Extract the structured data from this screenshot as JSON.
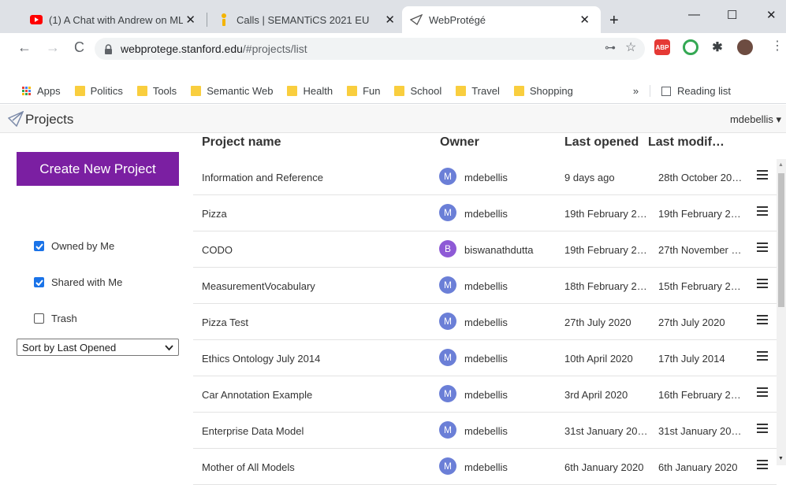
{
  "browser": {
    "tabs": [
      {
        "label": "(1) A Chat with Andrew on ML",
        "icon": "youtube-icon",
        "active": false
      },
      {
        "label": "Calls | SEMANTiCS 2021 EU",
        "icon": "semantics-icon",
        "active": false
      },
      {
        "label": "WebProtégé",
        "icon": "webprotege-icon",
        "active": true
      }
    ],
    "new_tab": "+",
    "url_host": "webprotege.stanford.edu",
    "url_path": "/#projects/list",
    "bookmarks": [
      "Apps",
      "Politics",
      "Tools",
      "Semantic Web",
      "Health",
      "Fun",
      "School",
      "Travel",
      "Shopping"
    ],
    "bookmarks_more": "»",
    "reading_list": "Reading list",
    "ext_abp": "ABP"
  },
  "app": {
    "title": "Projects",
    "user": "mdebellis ▾"
  },
  "sidebar": {
    "create_button": "Create New Project",
    "filters": [
      {
        "label": "Owned by Me",
        "checked": true
      },
      {
        "label": "Shared with Me",
        "checked": true
      },
      {
        "label": "Trash",
        "checked": false
      }
    ],
    "sort": "Sort by Last Opened"
  },
  "table": {
    "headers": {
      "name": "Project name",
      "owner": "Owner",
      "opened": "Last opened",
      "modified": "Last modif…"
    },
    "rows": [
      {
        "name": "Information and Reference",
        "initial": "M",
        "owner": "mdebellis",
        "opened": "9 days ago",
        "modified": "28th October 20…"
      },
      {
        "name": "Pizza",
        "initial": "M",
        "owner": "mdebellis",
        "opened": "19th February 2…",
        "modified": "19th February 2…"
      },
      {
        "name": "CODO",
        "initial": "B",
        "owner": "biswanathdutta",
        "opened": "19th February 2…",
        "modified": "27th November …"
      },
      {
        "name": "MeasurementVocabulary",
        "initial": "M",
        "owner": "mdebellis",
        "opened": "18th February 2…",
        "modified": "15th February 2…"
      },
      {
        "name": "Pizza Test",
        "initial": "M",
        "owner": "mdebellis",
        "opened": "27th July 2020",
        "modified": "27th July 2020"
      },
      {
        "name": "Ethics Ontology July 2014",
        "initial": "M",
        "owner": "mdebellis",
        "opened": "10th April 2020",
        "modified": "17th July 2014"
      },
      {
        "name": "Car Annotation Example",
        "initial": "M",
        "owner": "mdebellis",
        "opened": "3rd April 2020",
        "modified": "16th February 2…"
      },
      {
        "name": "Enterprise Data Model",
        "initial": "M",
        "owner": "mdebellis",
        "opened": "31st January 20…",
        "modified": "31st January 20…"
      },
      {
        "name": "Mother of All Models",
        "initial": "M",
        "owner": "mdebellis",
        "opened": "6th January 2020",
        "modified": "6th January 2020"
      }
    ]
  },
  "colors": {
    "accent": "#7b1fa2",
    "avatar_m": "#6b7fd7",
    "avatar_b": "#8e5ad6",
    "checkbox": "#1a73e8"
  }
}
